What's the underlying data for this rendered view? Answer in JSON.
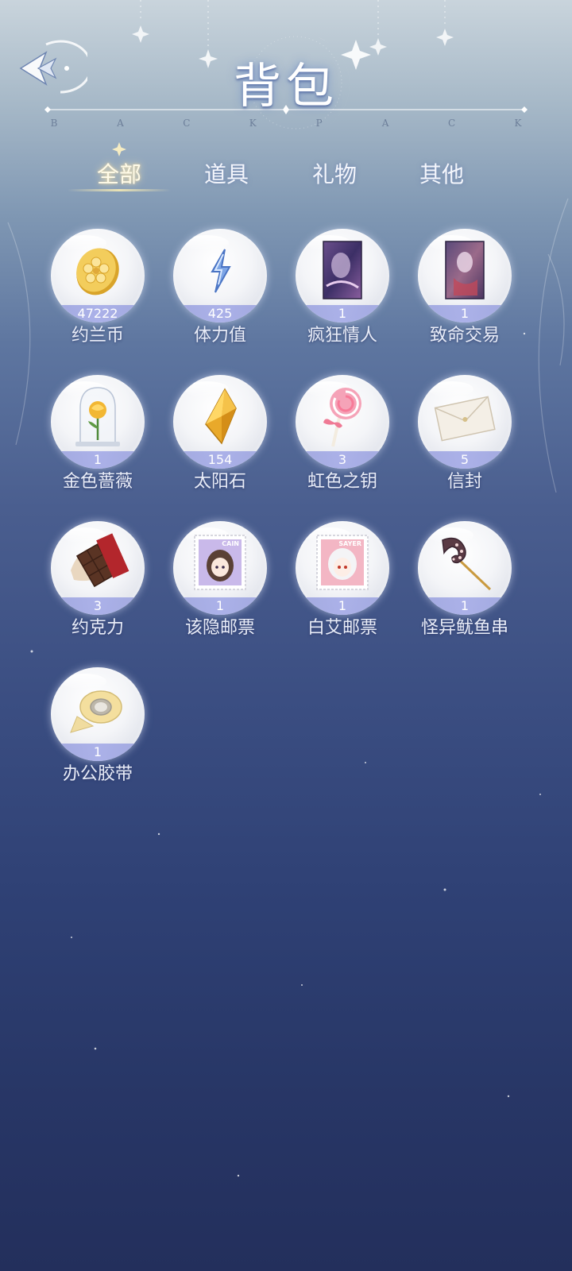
{
  "header": {
    "title": "背包",
    "subtitle_letters": [
      "B",
      "A",
      "C",
      "K",
      "P",
      "A",
      "C",
      "K"
    ]
  },
  "tabs": [
    {
      "label": "全部",
      "active": true
    },
    {
      "label": "道具",
      "active": false
    },
    {
      "label": "礼物",
      "active": false
    },
    {
      "label": "其他",
      "active": false
    }
  ],
  "items": [
    {
      "name": "约兰币",
      "count": "47222",
      "icon": "gold-coin-icon"
    },
    {
      "name": "体力值",
      "count": "425",
      "icon": "lightning-icon"
    },
    {
      "name": "疯狂情人",
      "count": "1",
      "icon": "card-crazy-lover-icon"
    },
    {
      "name": "致命交易",
      "count": "1",
      "icon": "card-deadly-deal-icon"
    },
    {
      "name": "金色蔷薇",
      "count": "1",
      "icon": "golden-rose-icon"
    },
    {
      "name": "太阳石",
      "count": "154",
      "icon": "sun-stone-icon"
    },
    {
      "name": "虹色之钥",
      "count": "3",
      "icon": "lollipop-icon"
    },
    {
      "name": "信封",
      "count": "5",
      "icon": "envelope-icon"
    },
    {
      "name": "约克力",
      "count": "3",
      "icon": "chocolate-icon"
    },
    {
      "name": "该隐邮票",
      "count": "1",
      "icon": "cain-stamp-icon"
    },
    {
      "name": "白艾邮票",
      "count": "1",
      "icon": "sayer-stamp-icon"
    },
    {
      "name": "怪异鱿鱼串",
      "count": "1",
      "icon": "squid-skewer-icon"
    },
    {
      "name": "办公胶带",
      "count": "1",
      "icon": "tape-roll-icon"
    }
  ],
  "stamps": {
    "cain_text": "CAIN",
    "sayer_text": "SAYER"
  },
  "colors": {
    "band": "#a8aee8",
    "active_tab": "#fffbe8"
  }
}
